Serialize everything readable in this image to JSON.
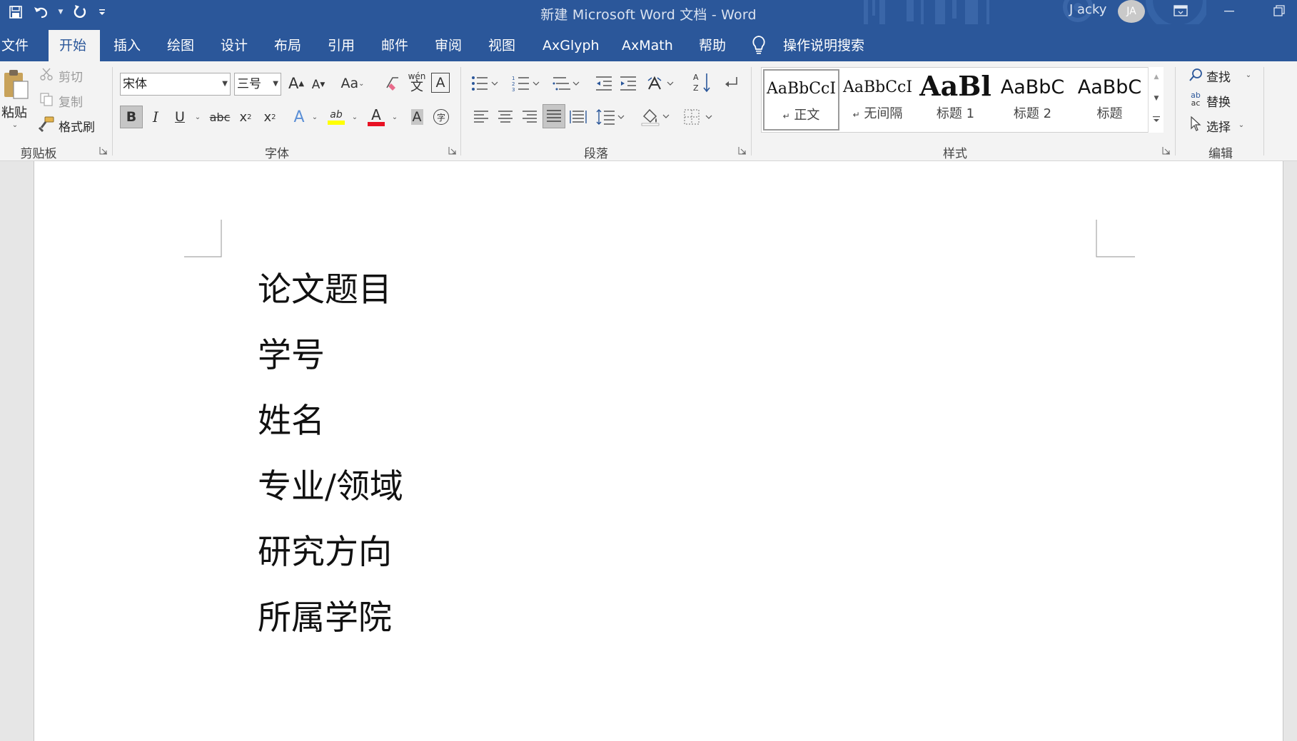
{
  "window": {
    "title": "新建 Microsoft Word 文档  -  Word",
    "user_name": "J acky",
    "user_initials": "JA"
  },
  "quick_access": {
    "icons": [
      "save-icon",
      "undo-icon",
      "redo-icon",
      "customize-qat-icon"
    ]
  },
  "tabs": [
    {
      "label": "文件",
      "active": false
    },
    {
      "label": "开始",
      "active": true
    },
    {
      "label": "插入",
      "active": false
    },
    {
      "label": "绘图",
      "active": false
    },
    {
      "label": "设计",
      "active": false
    },
    {
      "label": "布局",
      "active": false
    },
    {
      "label": "引用",
      "active": false
    },
    {
      "label": "邮件",
      "active": false
    },
    {
      "label": "审阅",
      "active": false
    },
    {
      "label": "视图",
      "active": false
    },
    {
      "label": "AxGlyph",
      "active": false
    },
    {
      "label": "AxMath",
      "active": false
    },
    {
      "label": "帮助",
      "active": false
    }
  ],
  "tell_me": "操作说明搜索",
  "ribbon": {
    "clipboard": {
      "label": "剪贴板",
      "paste": "粘贴",
      "cut": "剪切",
      "copy": "复制",
      "format_painter": "格式刷"
    },
    "font": {
      "label": "字体",
      "font_name": "宋体",
      "font_size": "三号",
      "change_case": "Aa",
      "phonetic_top": "wén",
      "phonetic_bottom": "文",
      "bold": "B",
      "italic": "I",
      "underline": "U",
      "strikethrough": "abc",
      "subscript": "x",
      "superscript": "x",
      "subscript_mark": "2",
      "superscript_mark": "2",
      "highlight_label": "ab",
      "font_color_label": "A",
      "char_shading": "A",
      "enclose_char": "字",
      "grow_font": "A",
      "shrink_font": "A",
      "char_border": "A",
      "text_effects": "A",
      "highlight_color": "#ffff00",
      "font_color": "#e81123"
    },
    "paragraph": {
      "label": "段落"
    },
    "styles": {
      "label": "样式",
      "items": [
        {
          "preview": "AaBbCcI",
          "name": "正文",
          "mark": "↵",
          "selected": true
        },
        {
          "preview": "AaBbCcI",
          "name": "无间隔",
          "mark": "↵",
          "selected": false
        },
        {
          "preview": "AaBl",
          "name": "标题 1",
          "mark": "",
          "selected": false
        },
        {
          "preview": "AaBbC",
          "name": "标题 2",
          "mark": "",
          "selected": false
        },
        {
          "preview": "AaBbC",
          "name": "标题",
          "mark": "",
          "selected": false
        }
      ]
    },
    "editing": {
      "label": "编辑",
      "find": "查找",
      "replace": "替换",
      "select": "选择",
      "replace_icon_top": "ab",
      "replace_icon_bottom": "ac"
    }
  },
  "document": {
    "lines": [
      "论文题目",
      "学号",
      "姓名",
      "专业/领域",
      "研究方向",
      "所属学院"
    ]
  },
  "colors": {
    "accent": "#2b579a",
    "ribbon_bg": "#f3f3f3",
    "page_bg": "#ffffff",
    "workspace_bg": "#e6e6e6"
  }
}
